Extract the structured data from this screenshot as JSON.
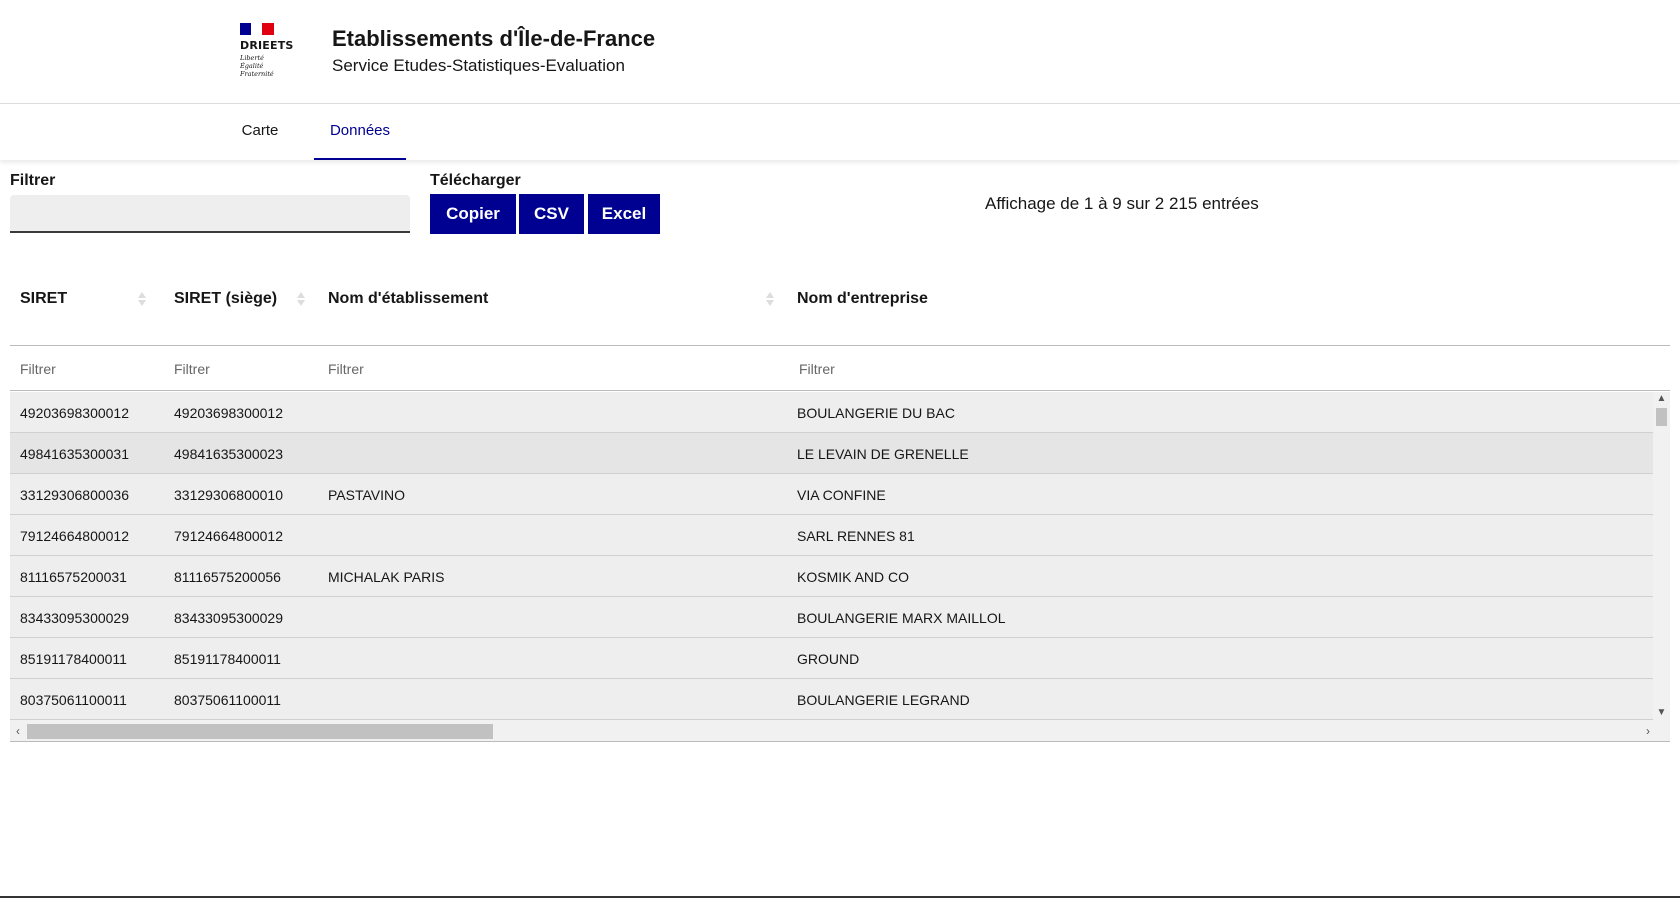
{
  "header": {
    "logo_name": "DRIEETS",
    "logo_motto": [
      "Liberté",
      "Égalité",
      "Fraternité"
    ],
    "title": "Etablissements d'Île-de-France",
    "subtitle": "Service Etudes-Statistiques-Evaluation"
  },
  "nav": {
    "items": [
      {
        "label": "Carte",
        "active": false
      },
      {
        "label": "Données",
        "active": true
      }
    ],
    "active_color": "#000091"
  },
  "toolbar": {
    "filter_label": "Filtrer",
    "filter_value": "",
    "download_label": "Télécharger",
    "buttons": [
      "Copier",
      "CSV",
      "Excel"
    ],
    "info": "Affichage de 1 à 9 sur 2 215 entrées"
  },
  "table": {
    "columns": [
      "SIRET",
      "SIRET (siège)",
      "Nom d'établissement",
      "Nom d'entreprise"
    ],
    "column_filter_placeholder": "Filtrer",
    "rows": [
      [
        "49203698300012",
        "49203698300012",
        "",
        "BOULANGERIE DU BAC"
      ],
      [
        "49841635300031",
        "49841635300023",
        "",
        "LE LEVAIN DE GRENELLE"
      ],
      [
        "33129306800036",
        "33129306800010",
        "PASTAVINO",
        "VIA CONFINE"
      ],
      [
        "79124664800012",
        "79124664800012",
        "",
        "SARL RENNES 81"
      ],
      [
        "81116575200031",
        "81116575200056",
        "MICHALAK PARIS",
        "KOSMIK AND CO"
      ],
      [
        "83433095300029",
        "83433095300029",
        "",
        "BOULANGERIE MARX MAILLOL"
      ],
      [
        "85191178400011",
        "85191178400011",
        "",
        "GROUND"
      ],
      [
        "80375061100011",
        "80375061100011",
        "",
        "BOULANGERIE LEGRAND"
      ]
    ]
  },
  "colors": {
    "primary": "#000091",
    "flag_blue": "#000091",
    "flag_red": "#e1000f"
  }
}
